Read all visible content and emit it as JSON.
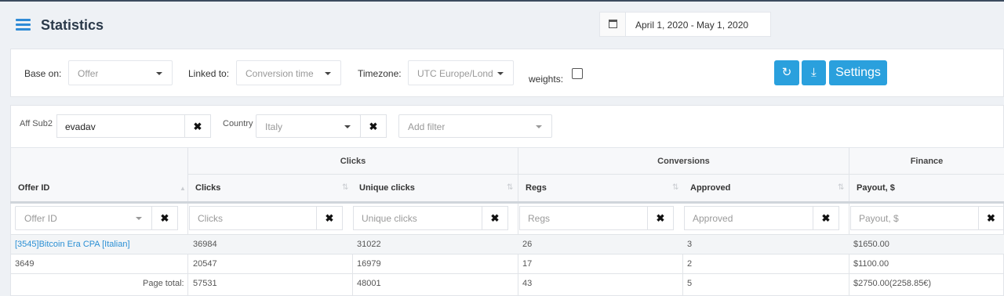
{
  "page": {
    "title": "Statistics"
  },
  "colors": {
    "accent": "#2aa0dd",
    "link": "#2a8fd4"
  },
  "toolbar": {
    "base_on_label": "Base on:",
    "base_on_value": "Offer",
    "linked_to_label": "Linked to:",
    "linked_to_value": "Conversion time",
    "timezone_label": "Timezone:",
    "timezone_value": "UTC Europe/Lond",
    "weights_label": "weights:",
    "date_range": "April 1, 2020 - May 1, 2020",
    "settings_label": "Settings",
    "icons": [
      "calendar-icon",
      "refresh-icon",
      "download-icon"
    ]
  },
  "filters": {
    "aff_sub2_label": "Aff Sub2",
    "aff_sub2_value": "evadav",
    "country_label": "Country",
    "country_value": "Italy",
    "add_filter_placeholder": "Add filter"
  },
  "table": {
    "groups": {
      "clicks": "Clicks",
      "conversions": "Conversions",
      "finance": "Finance"
    },
    "columns": {
      "offer_id": "Offer ID",
      "clicks": "Clicks",
      "unique_clicks": "Unique clicks",
      "regs": "Regs",
      "approved": "Approved",
      "payout": "Payout, $"
    },
    "column_filters": {
      "offer_id": "Offer ID",
      "clicks": "Clicks",
      "unique_clicks": "Unique clicks",
      "regs": "Regs",
      "approved": "Approved",
      "payout": "Payout, $"
    },
    "rows": [
      {
        "offer": "[3545]Bitcoin Era CPA [Italian]",
        "clicks": "36984",
        "unique_clicks": "31022",
        "regs": "26",
        "approved": "3",
        "payout": "$1650.00"
      },
      {
        "offer": "3649",
        "clicks": "20547",
        "unique_clicks": "16979",
        "regs": "17",
        "approved": "2",
        "payout": "$1100.00"
      }
    ],
    "total": {
      "label": "Page total:",
      "clicks": "57531",
      "unique_clicks": "48001",
      "regs": "43",
      "approved": "5",
      "payout": "$2750.00(2258.85€)"
    }
  }
}
